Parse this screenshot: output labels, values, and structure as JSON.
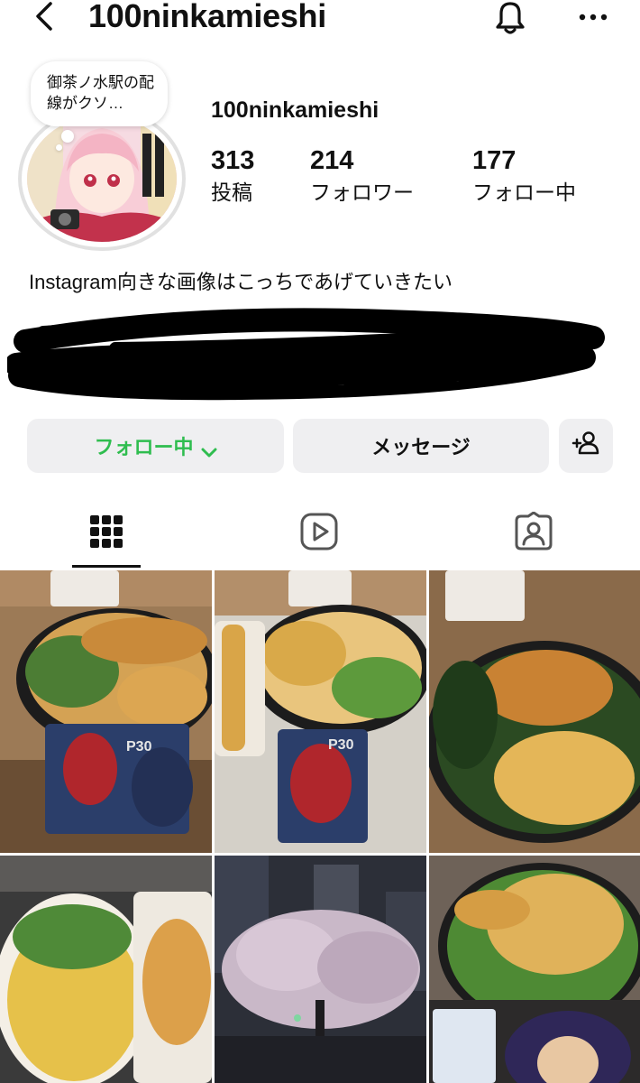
{
  "header": {
    "username": "100ninkamieshi"
  },
  "profile": {
    "name": "100ninkamieshi",
    "note_text": "御茶ノ水駅の配線がクソ…",
    "stats": [
      {
        "value": "313",
        "label": "投稿"
      },
      {
        "value": "214",
        "label": "フォロワー"
      },
      {
        "value": "177",
        "label": "フォロー中"
      }
    ],
    "bio": "Instagram向きな画像はこっちであげていきたい"
  },
  "actions": {
    "following_label": "フォロー中",
    "message_label": "メッセージ"
  },
  "photo_cards": {
    "card1": "P30",
    "card2": "P30"
  },
  "colors": {
    "following_green": "#2fbd4f",
    "button_bg": "#efeff1"
  },
  "icons": [
    "back-icon",
    "bell-icon",
    "more-icon",
    "chevron-down-icon",
    "add-user-icon",
    "grid-icon",
    "reels-icon",
    "tagged-icon"
  ]
}
